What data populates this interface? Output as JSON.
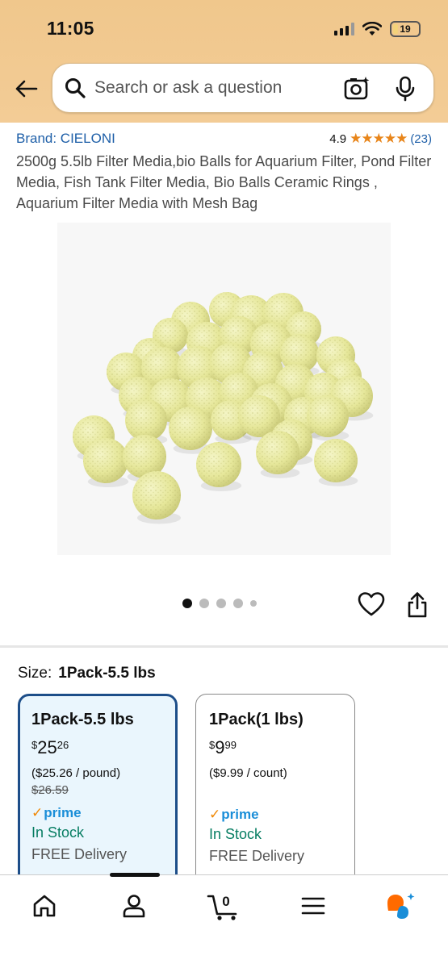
{
  "status_bar": {
    "time": "11:05",
    "battery": "19"
  },
  "search": {
    "placeholder": "Search or ask a question"
  },
  "product": {
    "brand": "Brand: CIELONI",
    "rating": "4.9",
    "stars": "★★★★★",
    "rating_count": "(23)",
    "title": "2500g 5.5lb Filter Media,bio Balls for Aquarium Filter, Pond Filter Media, Fish Tank Filter Media, Bio Balls Ceramic Rings , Aquarium Filter Media with Mesh Bag",
    "image_dots": {
      "count": 5,
      "active_index": 0
    }
  },
  "size": {
    "label": "Size:",
    "selected": "1Pack-5.5 lbs",
    "options": [
      {
        "name": "1Pack-5.5 lbs",
        "price_symbol": "$",
        "price_whole": "25",
        "price_cents": "26",
        "unit_price": "($25.26 / pound)",
        "old_price": "$26.59",
        "prime": "prime",
        "stock": "In Stock",
        "delivery": "FREE Delivery"
      },
      {
        "name": "1Pack(1 lbs)",
        "price_symbol": "$",
        "price_whole": "9",
        "price_cents": "99",
        "unit_price": "($9.99 / count)",
        "old_price": "",
        "prime": "prime",
        "stock": "In Stock",
        "delivery": "FREE Delivery"
      }
    ]
  },
  "bottom_nav": {
    "cart_count": "0"
  },
  "colors": {
    "header_bg": "#f0c78c",
    "link_blue": "#1e5fa8",
    "star_orange": "#e8851a",
    "prime_blue": "#1a8ed8",
    "in_stock_green": "#067d62",
    "selected_border": "#1d4e89",
    "selected_bg": "#eaf6fd"
  }
}
